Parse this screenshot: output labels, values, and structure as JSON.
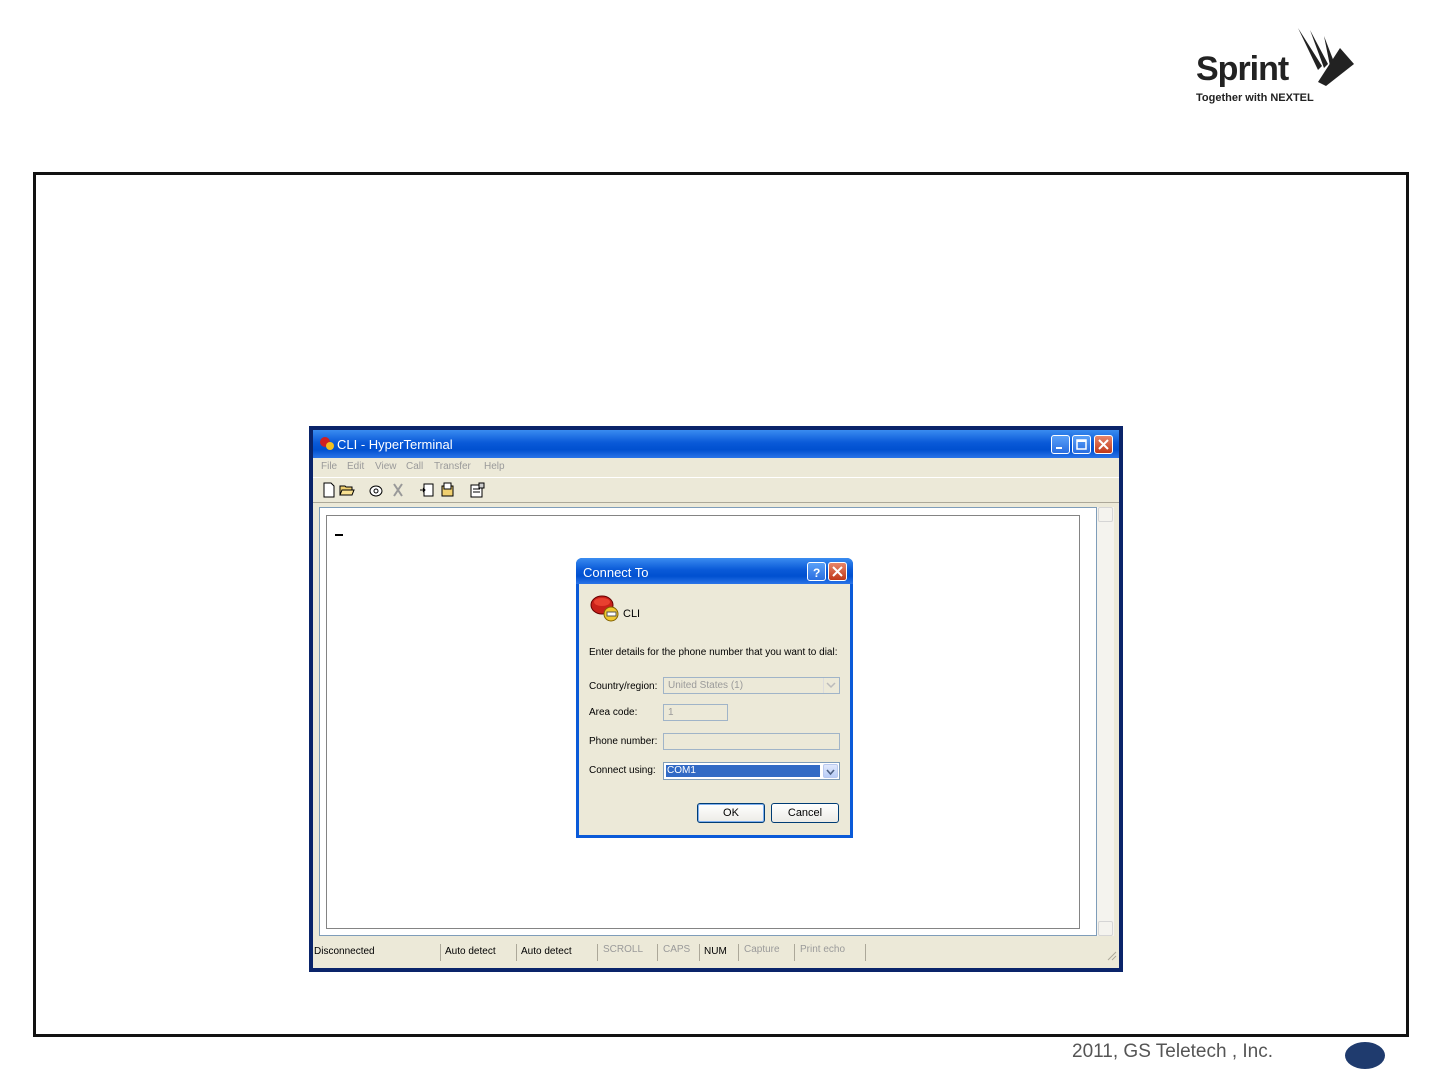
{
  "brand": {
    "name": "Sprint",
    "tagline": "Together with NEXTEL"
  },
  "footer": {
    "copyright": "2011, GS Teletech , Inc."
  },
  "window": {
    "title": "CLI - HyperTerminal",
    "menu": [
      "File",
      "Edit",
      "View",
      "Call",
      "Transfer",
      "Help"
    ],
    "toolbar_icons": [
      "new-icon",
      "open-icon",
      "call-icon",
      "disconnect-icon",
      "send-icon",
      "receive-icon",
      "properties-icon"
    ],
    "status": {
      "connection": "Disconnected",
      "detect1": "Auto detect",
      "detect2": "Auto detect",
      "scroll": "SCROLL",
      "caps": "CAPS",
      "num": "NUM",
      "capture": "Capture",
      "print_echo": "Print echo"
    }
  },
  "dialog": {
    "title": "Connect To",
    "connection_name": "CLI",
    "instruction": "Enter details for the phone number that you want to dial:",
    "country_label": "Country/region:",
    "country_value": "United States (1)",
    "area_label": "Area code:",
    "area_value": "1",
    "phone_label": "Phone number:",
    "phone_value": "",
    "connect_label": "Connect using:",
    "connect_value": "COM1",
    "ok": "OK",
    "cancel": "Cancel"
  },
  "colors": {
    "xp_title_blue": "#0a5ad8",
    "selection_blue": "#316ac5",
    "page_oval": "#1f3b6e",
    "frame": "#111111"
  }
}
